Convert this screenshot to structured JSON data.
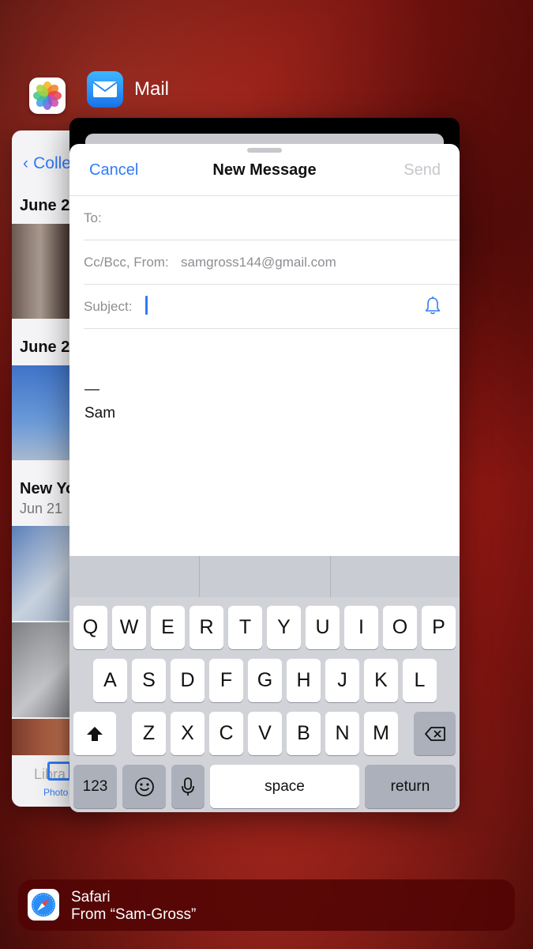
{
  "switcher": {
    "photos_app": {
      "back_label": "Colle",
      "sections": [
        {
          "title": "June 2",
          "subtitle": ""
        },
        {
          "title": "June 2",
          "subtitle": ""
        },
        {
          "title": "New Yo",
          "subtitle": "Jun 21"
        }
      ],
      "tab_library_label": "Libra",
      "tab_photos_label": "Photo"
    },
    "mail_app": {
      "name": "Mail"
    }
  },
  "compose": {
    "cancel_label": "Cancel",
    "title": "New Message",
    "send_label": "Send",
    "to_label": "To:",
    "ccbcc_label": "Cc/Bcc, From:",
    "from_value": "samgross144@gmail.com",
    "subject_label": "Subject:",
    "subject_value": "",
    "body_lines": [
      "—",
      "Sam"
    ]
  },
  "keyboard": {
    "row1": [
      "Q",
      "W",
      "E",
      "R",
      "T",
      "Y",
      "U",
      "I",
      "O",
      "P"
    ],
    "row2": [
      "A",
      "S",
      "D",
      "F",
      "G",
      "H",
      "J",
      "K",
      "L"
    ],
    "row3": [
      "Z",
      "X",
      "C",
      "V",
      "B",
      "N",
      "M"
    ],
    "numbers_label": "123",
    "space_label": "space",
    "return_label": "return"
  },
  "handoff": {
    "app": "Safari",
    "subtitle": "From “Sam-Gross”"
  },
  "colors": {
    "accent": "#2f7cf6",
    "background": "#8e1712"
  }
}
